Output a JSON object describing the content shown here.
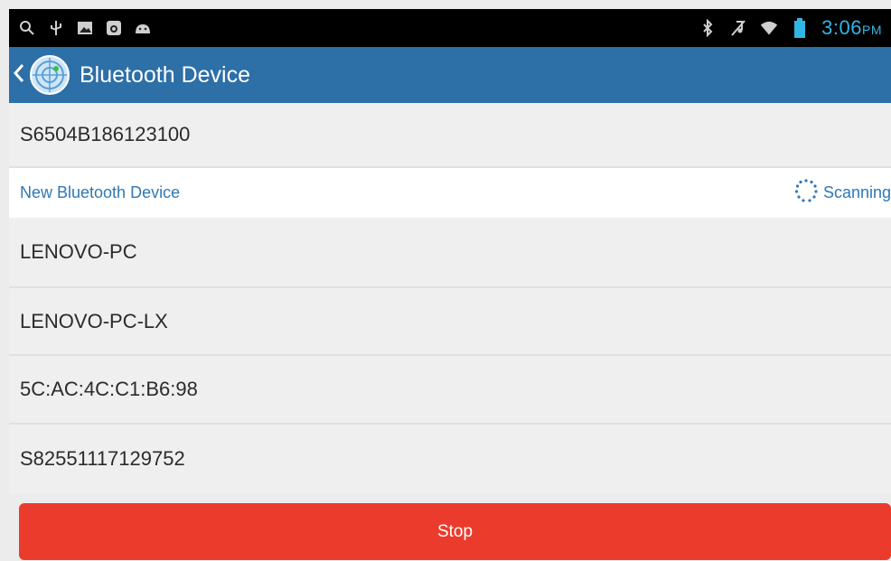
{
  "status_bar": {
    "time": "3:06",
    "ampm": "PM",
    "left_icons": [
      "search-icon",
      "usb-icon",
      "gallery-icon",
      "camera-icon",
      "android-debug-icon"
    ],
    "right_icons": [
      "bluetooth-icon",
      "mute-icon",
      "wifi-icon",
      "battery-icon"
    ]
  },
  "app_bar": {
    "title": "Bluetooth Device",
    "color": "#2d6fa7"
  },
  "paired_devices": [
    {
      "name": "S6504B186123100"
    }
  ],
  "new_devices_section": {
    "title": "New Bluetooth Device",
    "status": "Scanning"
  },
  "new_devices": [
    {
      "name": "LENOVO-PC"
    },
    {
      "name": "LENOVO-PC-LX"
    },
    {
      "name": "5C:AC:4C:C1:B6:98"
    },
    {
      "name": "S82551117129752"
    }
  ],
  "stop_button": {
    "label": "Stop",
    "color": "#eb3b2c"
  }
}
